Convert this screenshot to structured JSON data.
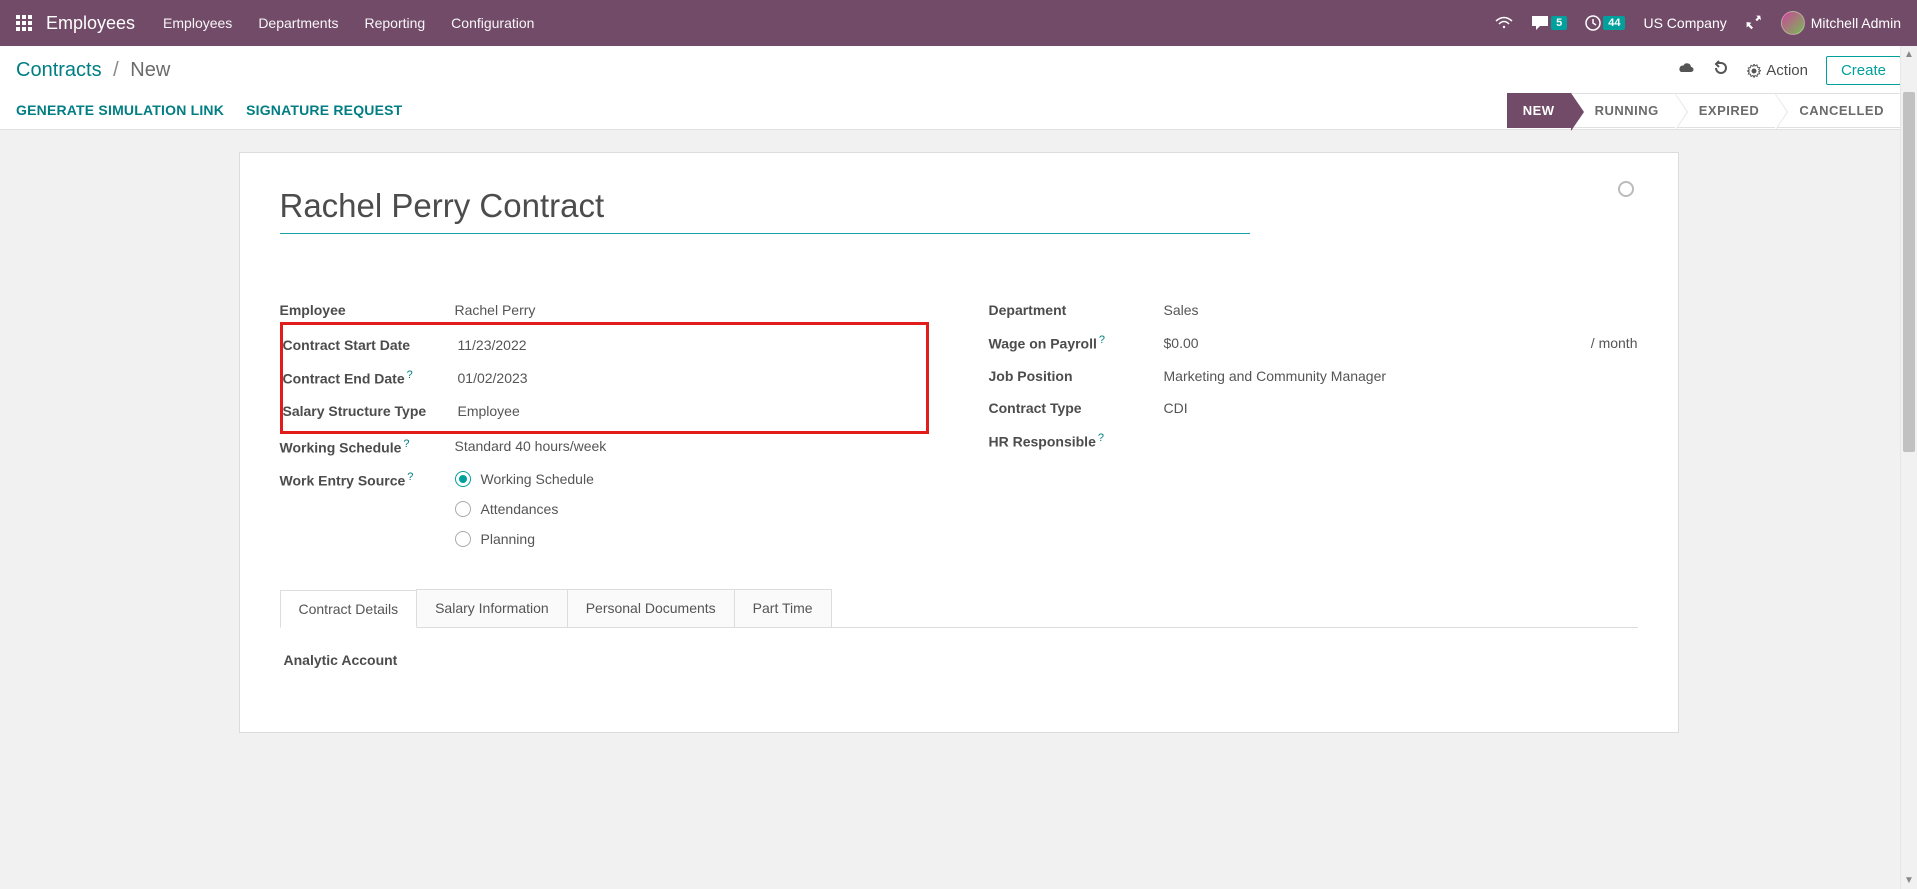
{
  "navbar": {
    "app_name": "Employees",
    "menu": [
      "Employees",
      "Departments",
      "Reporting",
      "Configuration"
    ],
    "msg_badge": "5",
    "activity_badge": "44",
    "company": "US Company",
    "user": "Mitchell Admin"
  },
  "breadcrumb": {
    "root": "Contracts",
    "current": "New"
  },
  "control": {
    "action_label": "Action",
    "create_label": "Create",
    "gen_sim": "GENERATE SIMULATION LINK",
    "sig_req": "SIGNATURE REQUEST"
  },
  "statuses": [
    "NEW",
    "RUNNING",
    "EXPIRED",
    "CANCELLED"
  ],
  "active_status": "NEW",
  "record": {
    "title": "Rachel Perry Contract",
    "left": {
      "employee_label": "Employee",
      "employee": "Rachel Perry",
      "start_label": "Contract Start Date",
      "start": "11/23/2022",
      "end_label": "Contract End Date",
      "end": "01/02/2023",
      "struct_label": "Salary Structure Type",
      "struct": "Employee",
      "sched_label": "Working Schedule",
      "sched": "Standard 40 hours/week",
      "wes_label": "Work Entry Source",
      "wes_options": {
        "a": "Working Schedule",
        "b": "Attendances",
        "c": "Planning"
      }
    },
    "right": {
      "dept_label": "Department",
      "dept": "Sales",
      "wage_label": "Wage on Payroll",
      "wage": "$0.00",
      "wage_suffix": "/ month",
      "job_label": "Job Position",
      "job": "Marketing and Community Manager",
      "ctype_label": "Contract Type",
      "ctype": "CDI",
      "hr_label": "HR Responsible",
      "hr": ""
    }
  },
  "tabs": [
    "Contract Details",
    "Salary Information",
    "Personal Documents",
    "Part Time"
  ],
  "tab_content": {
    "analytic_label": "Analytic Account"
  }
}
